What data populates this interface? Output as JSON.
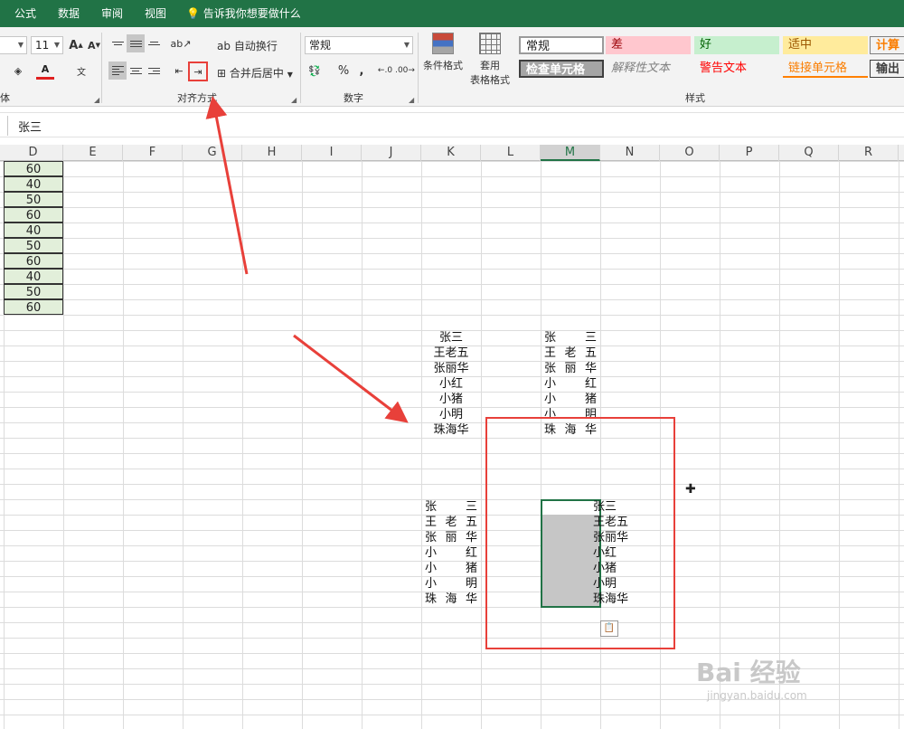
{
  "tabs": [
    "公式",
    "数据",
    "审阅",
    "视图"
  ],
  "tell_me": "告诉我你想要做什么",
  "ribbon": {
    "font_size": "11",
    "font_grow": "A",
    "font_shrink": "A",
    "font_color_letter": "A",
    "wrap_text": "自动换行",
    "merge_center": "合并后居中",
    "number_format": "常规",
    "percent": "%",
    "comma": ",",
    "cond_format": "条件格式",
    "table_format": [
      "套用",
      "表格格式"
    ],
    "group_font_tail": "体",
    "group_align": "对齐方式",
    "group_number": "数字",
    "group_styles": "样式",
    "styles": {
      "normal": "常规",
      "bad": "差",
      "good": "好",
      "neutral": "适中",
      "calc": "计算",
      "check": "检查单元格",
      "explain": "解释性文本",
      "warn": "警告文本",
      "link": "链接单元格",
      "output": "输出"
    }
  },
  "formula_bar": {
    "value": "张三"
  },
  "columns": [
    "D",
    "E",
    "F",
    "G",
    "H",
    "I",
    "J",
    "K",
    "L",
    "M",
    "N",
    "O",
    "P",
    "Q",
    "R"
  ],
  "active_column": "M",
  "col_d_values": [
    "60",
    "40",
    "50",
    "60",
    "40",
    "50",
    "60",
    "40",
    "50",
    "60"
  ],
  "names": [
    "张三",
    "王老五",
    "张丽华",
    "小红",
    "小猪",
    "小明",
    "珠海华"
  ],
  "watermark": {
    "brand": "Bai 经验",
    "url": "jingyan.baidu.com"
  },
  "colors": {
    "excel_green": "#217346",
    "annotation_red": "#e8403a"
  }
}
